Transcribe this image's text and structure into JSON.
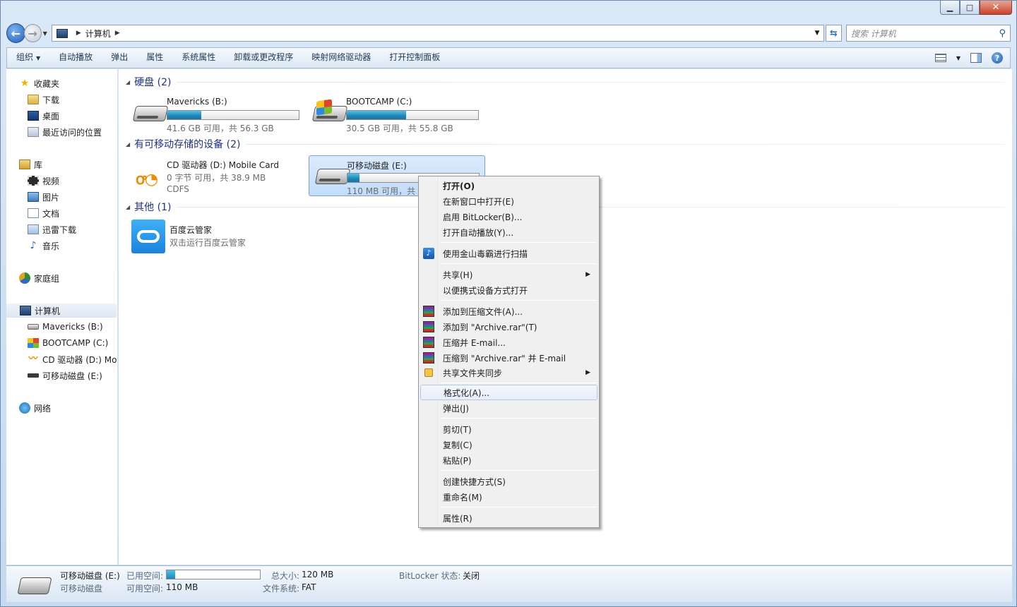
{
  "window": {
    "caption_min": "▁",
    "caption_max": "□",
    "caption_close": "✕"
  },
  "address": {
    "crumb": "计算机",
    "search_placeholder": "搜索 计算机"
  },
  "toolbar": {
    "organize": "组织",
    "autoplay": "自动播放",
    "eject": "弹出",
    "properties": "属性",
    "system_properties": "系统属性",
    "uninstall": "卸载或更改程序",
    "map_drive": "映射网络驱动器",
    "control_panel": "打开控制面板",
    "help": "?"
  },
  "nav": {
    "favorites": "收藏夹",
    "downloads": "下载",
    "desktop": "桌面",
    "recent": "最近访问的位置",
    "libraries": "库",
    "videos": "视频",
    "pictures": "图片",
    "documents": "文档",
    "xunlei": "迅雷下载",
    "music": "音乐",
    "homegroup": "家庭组",
    "computer": "计算机",
    "drive_b": "Mavericks (B:)",
    "drive_c": "BOOTCAMP (C:)",
    "drive_d": "CD 驱动器 (D:) Mo",
    "drive_e": "可移动磁盘 (E:)",
    "network": "网络"
  },
  "groups": {
    "hdd": "硬盘 (2)",
    "removable": "有可移动存储的设备 (2)",
    "other": "其他 (1)"
  },
  "drives": {
    "b": {
      "name": "Mavericks (B:)",
      "info": "41.6 GB 可用，共 56.3 GB",
      "used_fraction": 0.26
    },
    "c": {
      "name": "BOOTCAMP (C:)",
      "info": "30.5 GB 可用，共 55.8 GB",
      "used_fraction": 0.45
    },
    "d": {
      "name": "CD 驱动器 (D:) Mobile Card",
      "info": "0 字节 可用，共 38.9 MB",
      "fs": "CDFS"
    },
    "e": {
      "name": "可移动磁盘 (E:)",
      "info": "110 MB 可用，共",
      "used_fraction": 0.09
    },
    "baidu": {
      "name": "百度云管家",
      "info": "双击运行百度云管家"
    }
  },
  "menu": {
    "open": "打开(O)",
    "open_new": "在新窗口中打开(E)",
    "bitlocker": "启用 BitLocker(B)...",
    "autoplay": "打开自动播放(Y)...",
    "scan": "使用金山毒霸进行扫描",
    "share": "共享(H)",
    "portable": "以便携式设备方式打开",
    "rar_add": "添加到压缩文件(A)...",
    "rar_archive": "添加到 \"Archive.rar\"(T)",
    "rar_email": "压缩并 E-mail...",
    "rar_archive_email": "压缩到 \"Archive.rar\" 并 E-mail",
    "sync": "共享文件夹同步",
    "format": "格式化(A)...",
    "eject": "弹出(J)",
    "cut": "剪切(T)",
    "copy": "复制(C)",
    "paste": "粘贴(P)",
    "shortcut": "创建快捷方式(S)",
    "rename": "重命名(M)",
    "properties": "属性(R)"
  },
  "details": {
    "name": "可移动磁盘 (E:)",
    "type": "可移动磁盘",
    "used_label": "已用空间:",
    "free_label": "可用空间:",
    "free_value": "110 MB",
    "total_label": "总大小:",
    "total_value": "120 MB",
    "fs_label": "文件系统:",
    "fs_value": "FAT",
    "bitlocker_label": "BitLocker 状态:",
    "bitlocker_value": "关闭",
    "used_fraction": 0.09
  }
}
